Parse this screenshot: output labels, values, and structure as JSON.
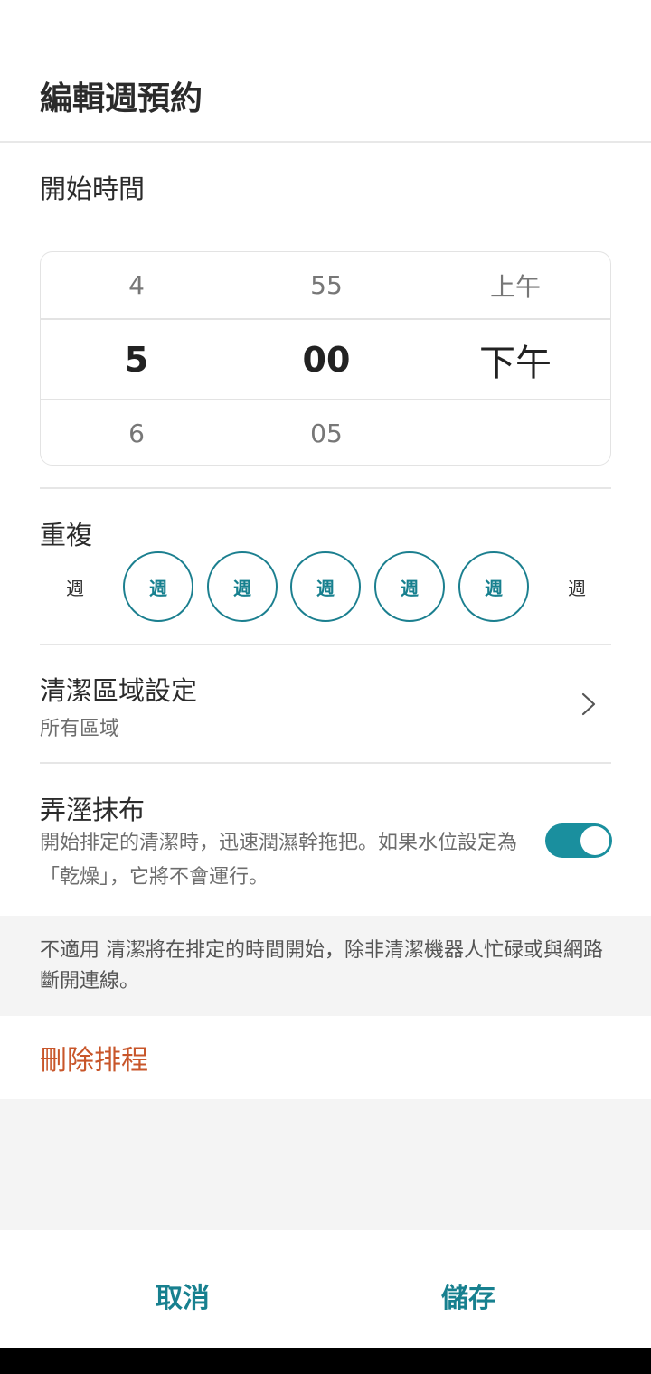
{
  "header": {
    "title": "編輯週預約"
  },
  "start_time": {
    "label": "開始時間",
    "picker": {
      "hours": {
        "prev": "4",
        "selected": "5",
        "next": "6"
      },
      "minutes": {
        "prev": "55",
        "selected": "00",
        "next": "05"
      },
      "period": {
        "prev": "上午",
        "selected": "下午",
        "next": ""
      }
    }
  },
  "repeat": {
    "label": "重複",
    "days": [
      {
        "label": "週",
        "selected": false
      },
      {
        "label": "週",
        "selected": true
      },
      {
        "label": "週",
        "selected": true
      },
      {
        "label": "週",
        "selected": true
      },
      {
        "label": "週",
        "selected": true
      },
      {
        "label": "週",
        "selected": true
      },
      {
        "label": "週",
        "selected": false
      }
    ],
    "accent_color": "#17808f"
  },
  "cleaning_area": {
    "title": "清潔區域設定",
    "value": "所有區域",
    "icon": "chevron-right-icon"
  },
  "mop": {
    "title": "弄溼抹布",
    "description": "開始排定的清潔時，迅速潤濕幹拖把。如果水位設定為「乾燥」，它將不會運行。",
    "toggle_on": true,
    "toggle_color": "#1a8f9e"
  },
  "notice": {
    "text": "不適用 清潔將在排定的時間開始，除非清潔機器人忙碌或與網路斷開連線。"
  },
  "delete": {
    "label": "刪除排程",
    "color": "#c8562a"
  },
  "footer": {
    "cancel_label": "取消",
    "save_label": "儲存"
  }
}
